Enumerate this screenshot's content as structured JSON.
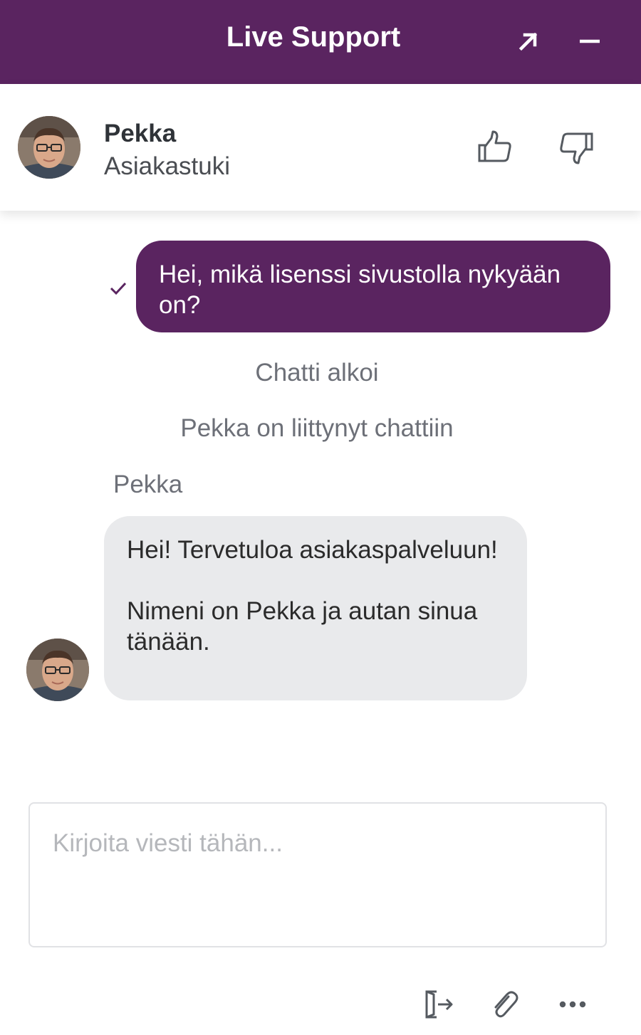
{
  "header": {
    "title": "Live Support",
    "expand_icon": "arrow-up-right-icon",
    "minimize_icon": "minus-icon",
    "background": "#5a2460"
  },
  "agent": {
    "name": "Pekka",
    "role": "Asiakastuki",
    "rate_up_icon": "thumbs-up-icon",
    "rate_down_icon": "thumbs-down-icon"
  },
  "messages": {
    "outgoing": {
      "text": "Hei, mikä lisenssi sivustolla nykyään on?",
      "status_icon": "checkmark-icon"
    },
    "system": [
      "Chatti alkoi",
      "Pekka on liittynyt chattiin"
    ],
    "incoming": {
      "sender": "Pekka",
      "line1": "Hei! Tervetuloa asiakaspalveluun!",
      "line2": "Nimeni on Pekka ja autan sinua tänään."
    }
  },
  "composer": {
    "placeholder": "Kirjoita viesti tähän...",
    "value": ""
  },
  "toolbar": {
    "exit_icon": "exit-chat-icon",
    "attach_icon": "paperclip-icon",
    "more_icon": "more-options-icon"
  },
  "colors": {
    "brand": "#5a2460",
    "bubble_in": "#e9eaec",
    "system_text": "#6d7078"
  }
}
